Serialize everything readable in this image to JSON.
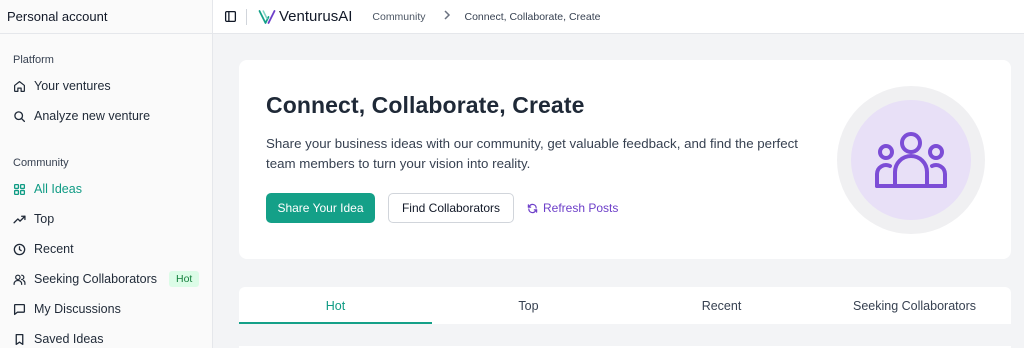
{
  "sidebar": {
    "header": "Personal account",
    "sections": [
      {
        "title": "Platform"
      },
      {
        "title": "Community"
      }
    ],
    "items": [
      {
        "label": "Your ventures",
        "icon": "home-icon"
      },
      {
        "label": "Analyze new venture",
        "icon": "search-icon"
      },
      {
        "label": "All Ideas",
        "icon": "grid-icon",
        "active": true
      },
      {
        "label": "Top",
        "icon": "trending-up-icon"
      },
      {
        "label": "Recent",
        "icon": "clock-icon"
      },
      {
        "label": "Seeking Collaborators",
        "icon": "users-icon",
        "badge": "Hot"
      },
      {
        "label": "My Discussions",
        "icon": "message-square-icon"
      },
      {
        "label": "Saved Ideas",
        "icon": "bookmark-icon"
      }
    ]
  },
  "topbar": {
    "brand": "VenturusAI",
    "breadcrumb": [
      "Community",
      "Connect, Collaborate, Create"
    ]
  },
  "hero": {
    "title": "Connect, Collaborate, Create",
    "description": "Share your business ideas with our community, get valuable feedback, and find the perfect team members to turn your vision into reality.",
    "primary_button": "Share Your Idea",
    "secondary_button": "Find Collaborators",
    "refresh_link": "Refresh Posts"
  },
  "tabs": [
    {
      "label": "Hot",
      "active": true
    },
    {
      "label": "Top"
    },
    {
      "label": "Recent"
    },
    {
      "label": "Seeking Collaborators"
    }
  ],
  "colors": {
    "accent": "#14a088",
    "purple": "#6d3fc9",
    "hot_badge_bg": "#dcfce7"
  }
}
